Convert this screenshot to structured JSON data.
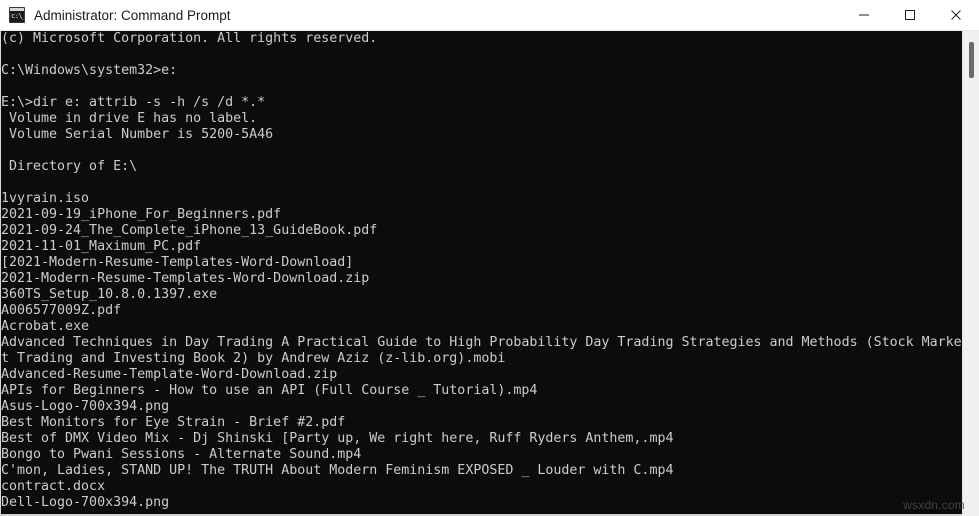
{
  "window": {
    "title": "Administrator: Command Prompt",
    "icon": "command-prompt-icon",
    "icon_glyph": "c:\\_",
    "background_color": "#0c0c0c",
    "foreground_color": "#cccccc",
    "titlebar_color": "#ffffff"
  },
  "titlebar_controls": {
    "minimize_label": "Minimize",
    "maximize_label": "Maximize",
    "close_label": "Close"
  },
  "scrollbar": {
    "track_color": "#f0f0f0",
    "thumb_color": "#6b6b6b"
  },
  "watermark": {
    "text": "wsxdn.com"
  },
  "console": {
    "lines": [
      "(c) Microsoft Corporation. All rights reserved.",
      "",
      "C:\\Windows\\system32>e:",
      "",
      "E:\\>dir e: attrib -s -h /s /d *.*",
      " Volume in drive E has no label.",
      " Volume Serial Number is 5200-5A46",
      "",
      " Directory of E:\\",
      "",
      "1vyrain.iso",
      "2021-09-19_iPhone_For_Beginners.pdf",
      "2021-09-24_The_Complete_iPhone_13_GuideBook.pdf",
      "2021-11-01_Maximum_PC.pdf",
      "[2021-Modern-Resume-Templates-Word-Download]",
      "2021-Modern-Resume-Templates-Word-Download.zip",
      "360TS_Setup_10.8.0.1397.exe",
      "A006577009Z.pdf",
      "Acrobat.exe",
      "Advanced Techniques in Day Trading A Practical Guide to High Probability Day Trading Strategies and Methods (Stock Marke",
      "t Trading and Investing Book 2) by Andrew Aziz (z-lib.org).mobi",
      "Advanced-Resume-Template-Word-Download.zip",
      "APIs for Beginners - How to use an API (Full Course _ Tutorial).mp4",
      "Asus-Logo-700x394.png",
      "Best Monitors for Eye Strain - Brief #2.pdf",
      "Best of DMX Video Mix - Dj Shinski [Party up, We right here, Ruff Ryders Anthem,.mp4",
      "Bongo to Pwani Sessions - Alternate Sound.mp4",
      "C'mon, Ladies, STAND UP! The TRUTH About Modern Feminism EXPOSED _ Louder with C.mp4",
      "contract.docx",
      "Dell-Logo-700x394.png"
    ]
  }
}
